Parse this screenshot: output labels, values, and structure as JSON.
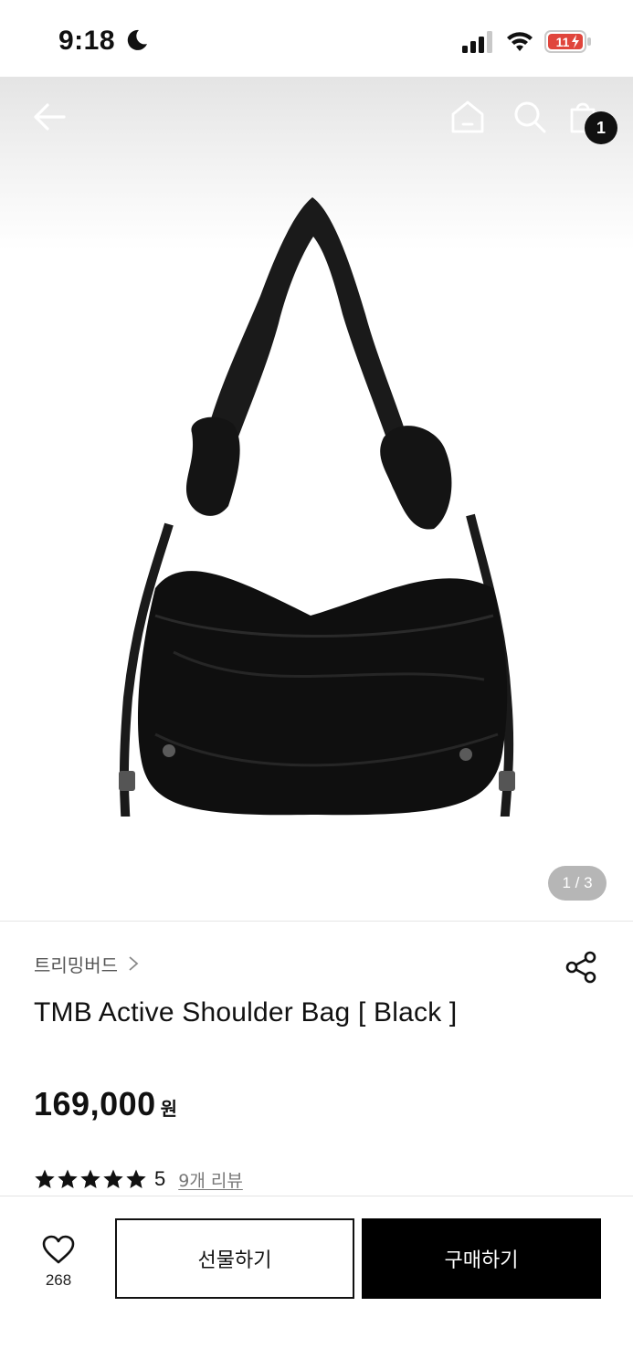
{
  "status_bar": {
    "time": "9:18",
    "battery_level": "11",
    "icons": [
      "moon-icon",
      "cellular-signal-icon",
      "wifi-icon",
      "battery-icon"
    ]
  },
  "top_nav": {
    "icons": [
      "back-arrow-icon",
      "home-icon",
      "search-icon",
      "shopping-bag-icon"
    ],
    "cart_count": "1"
  },
  "gallery": {
    "current_page": "1 / 3"
  },
  "product": {
    "brand": "트리밍버드",
    "name": "TMB Active Shoulder Bag [ Black ]",
    "price": "169,000",
    "currency": "원",
    "rating_stars": 5,
    "rating": "5",
    "review_link": "9개 리뷰"
  },
  "actions": {
    "like_count": "268",
    "gift_label": "선물하기",
    "buy_label": "구매하기"
  },
  "colors": {
    "primary": "#000000",
    "pager_bg": "#b6b6b6",
    "battery_low": "#e0453c"
  }
}
